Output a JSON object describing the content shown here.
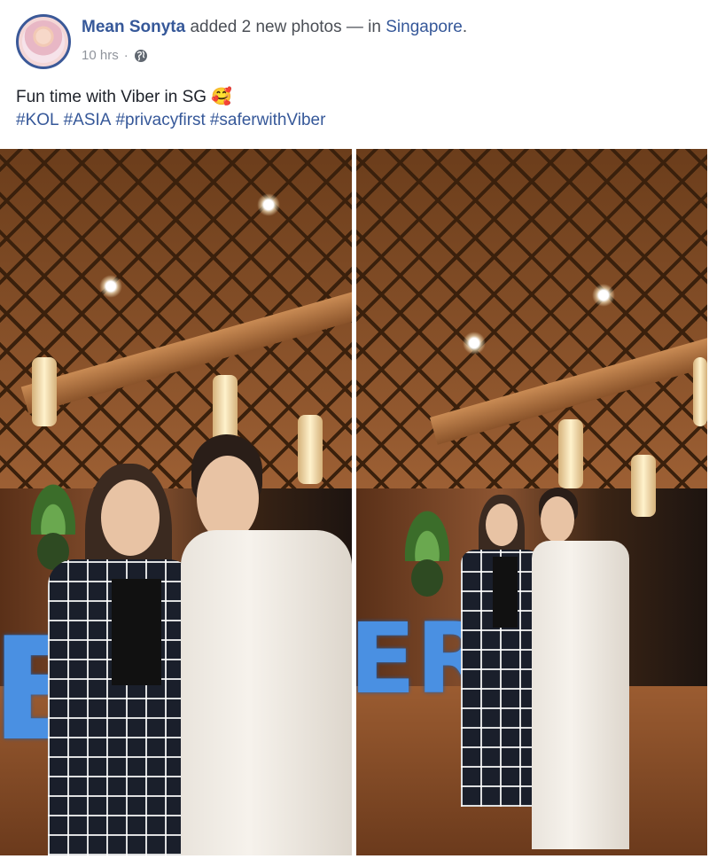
{
  "post": {
    "author": "Mean Sonyta",
    "action": " added 2 new photos — in ",
    "location": "Singapore",
    "after_location": ".",
    "time": "10 hrs",
    "separator": "·",
    "caption": "Fun time with Viber in SG 🥰",
    "hashtags": [
      "#KOL",
      "#ASIA",
      "#privacyfirst",
      "#saferwithViber"
    ]
  },
  "icons": {
    "avatar": "profile-photo",
    "audience": "globe-icon"
  },
  "photos": {
    "left": {
      "sign_text": "ER"
    },
    "right": {
      "sign_text": "ER"
    }
  },
  "colors": {
    "link": "#365899",
    "meta": "#90949c",
    "avatar_ring": "#3b5998"
  }
}
